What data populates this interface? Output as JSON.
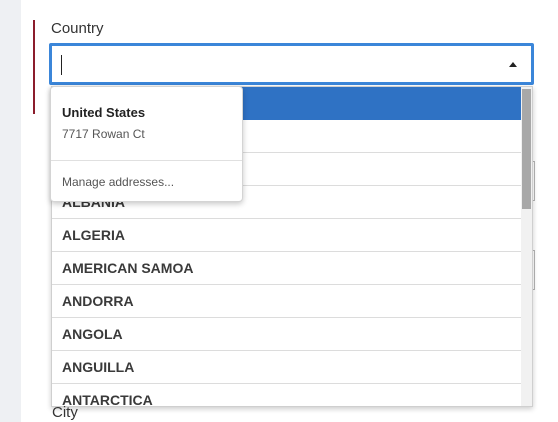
{
  "form": {
    "country_label": "Country",
    "city_label": "City",
    "country_input_value": ""
  },
  "dropdown": {
    "options": [
      "",
      "",
      "",
      "ALBANIA",
      "ALGERIA",
      "AMERICAN SAMOA",
      "ANDORRA",
      "ANGOLA",
      "ANGUILLA",
      "ANTARCTICA"
    ],
    "selected_index": 0
  },
  "autofill": {
    "suggestion_name": "United States",
    "suggestion_address": "7717 Rowan Ct",
    "manage_label": "Manage addresses..."
  },
  "colors": {
    "focus_border": "#3b86d9",
    "selected_row": "#2f72c4",
    "accent_bar": "#8b1d2c"
  },
  "icons": {
    "dropdown_arrow": "chevron-up-icon"
  }
}
